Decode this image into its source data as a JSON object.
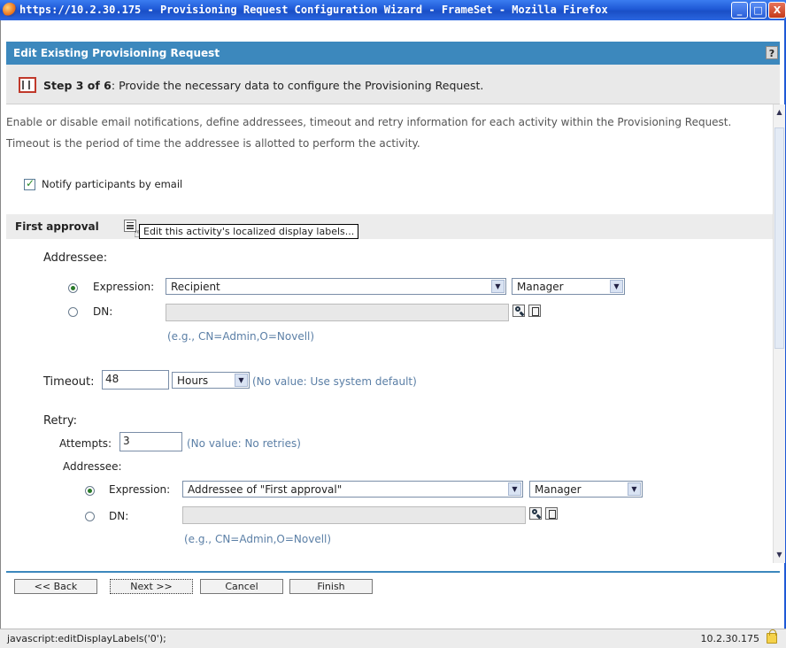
{
  "window": {
    "title": "https://10.2.30.175 - Provisioning Request Configuration Wizard - FrameSet - Mozilla Firefox",
    "minimize": "_",
    "maximize": "□",
    "close": "X"
  },
  "header": {
    "title": "Edit Existing Provisioning Request",
    "help": "?"
  },
  "step": {
    "label": "Step 3 of 6",
    "text": ": Provide the necessary data to configure the Provisioning Request."
  },
  "description": "Enable or disable email notifications, define addressees, timeout and retry information for each activity within the Provisioning Request.  Timeout is the period of time the addressee is allotted to perform the activity.",
  "notify": {
    "label": "Notify participants by email",
    "checked": true
  },
  "activity": {
    "title": "First approval",
    "tooltip": "Edit this activity's localized display labels..."
  },
  "addressee": {
    "label": "Addressee:",
    "expression_label": "Expression:",
    "expression_value": "Recipient",
    "expression_type": "Manager",
    "dn_label": "DN:",
    "dn_value": "",
    "hint": "(e.g., CN=Admin,O=Novell)"
  },
  "timeout": {
    "label": "Timeout:",
    "value": "48",
    "unit": "Hours",
    "hint": "(No value: Use system default)"
  },
  "retry": {
    "label": "Retry:",
    "attempts_label": "Attempts:",
    "attempts_value": "3",
    "attempts_hint": "(No value: No retries)",
    "addressee_label": "Addressee:",
    "expression_label": "Expression:",
    "expression_value": "Addressee of \"First approval\"",
    "expression_type": "Manager",
    "dn_label": "DN:",
    "dn_value": "",
    "hint": "(e.g., CN=Admin,O=Novell)"
  },
  "buttons": {
    "back": "<< Back",
    "next": "Next >>",
    "cancel": "Cancel",
    "finish": "Finish"
  },
  "status": {
    "text": "javascript:editDisplayLabels('0');",
    "host": "10.2.30.175"
  },
  "colors": {
    "titlebar": "#2a62dc",
    "header": "#3c88bd",
    "hint": "#5b7fa6"
  }
}
